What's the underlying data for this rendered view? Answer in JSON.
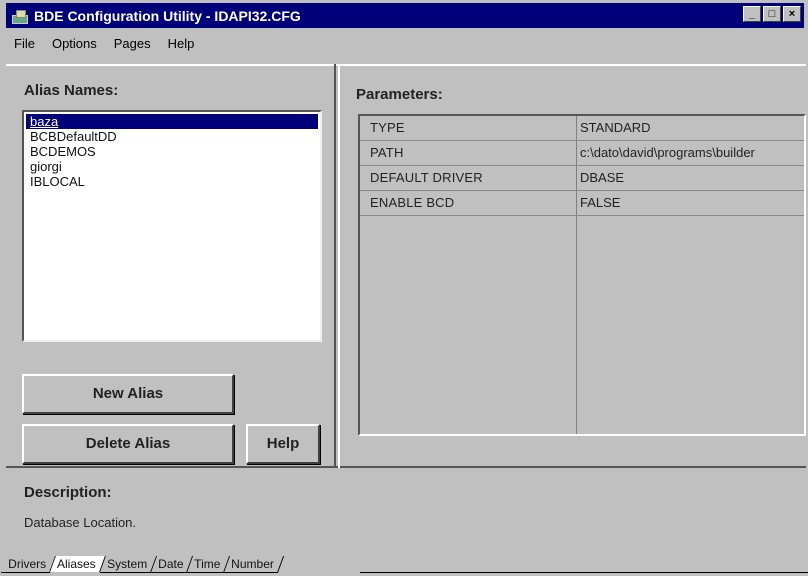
{
  "window": {
    "title": "BDE Configuration Utility - IDAPI32.CFG",
    "min_label": "_",
    "max_label": "□",
    "close_label": "×"
  },
  "menu": [
    "File",
    "Options",
    "Pages",
    "Help"
  ],
  "aliases": {
    "label": "Alias Names:",
    "items": [
      "baza",
      "BCBDefaultDD",
      "BCDEMOS",
      "giorgi",
      "IBLOCAL"
    ],
    "selected": "baza"
  },
  "buttons": {
    "new_alias": "New Alias",
    "delete_alias": "Delete Alias",
    "help": "Help"
  },
  "parameters": {
    "label": "Parameters:",
    "rows": [
      {
        "name": "TYPE",
        "value": "STANDARD"
      },
      {
        "name": "PATH",
        "value": "c:\\dato\\david\\programs\\builder"
      },
      {
        "name": "DEFAULT DRIVER",
        "value": "DBASE"
      },
      {
        "name": "ENABLE BCD",
        "value": "FALSE"
      }
    ]
  },
  "description": {
    "label": "Description:",
    "text": "Database Location."
  },
  "tabs": [
    "Drivers",
    "Aliases",
    "System",
    "Date",
    "Time",
    "Number"
  ],
  "active_tab": "Aliases",
  "colors": {
    "titlebar": "#00007b",
    "face": "#c0c0c0",
    "selection": "#00007b"
  }
}
